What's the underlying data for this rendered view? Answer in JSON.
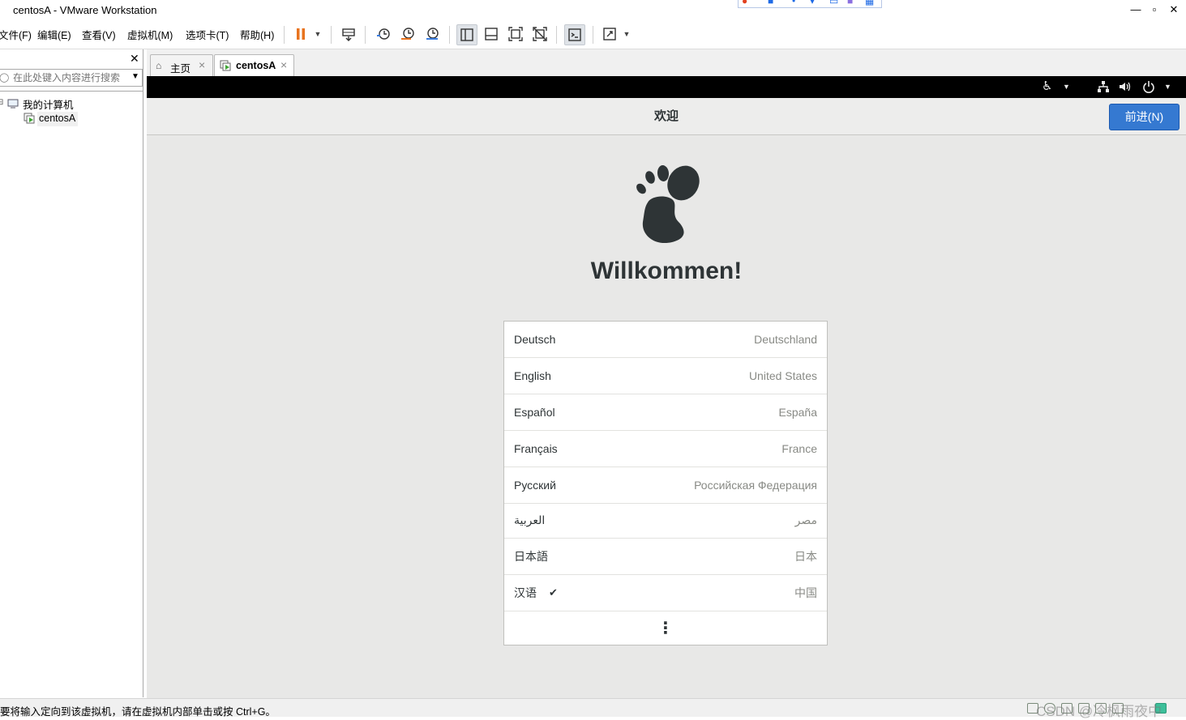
{
  "window": {
    "title": "centosA - VMware Workstation",
    "controls": [
      "minimize-icon",
      "maximize-icon",
      "close-icon"
    ]
  },
  "menu": [
    "文件(F)",
    "编辑(E)",
    "查看(V)",
    "虚拟机(M)",
    "选项卡(T)",
    "帮助(H)"
  ],
  "toolbar_icons": [
    "pause-icon",
    "send-ctrl-alt-del-icon",
    "snapshot-icon",
    "revert-snapshot-icon",
    "snapshot-manager-icon",
    "show-library-icon",
    "thumbnail-bar-icon",
    "full-screen-icon",
    "unity-icon",
    "console-view-icon",
    "stretch-icon"
  ],
  "library": {
    "search_placeholder": "在此处键入内容进行搜索",
    "tree": [
      {
        "label": "我的计算机",
        "icon": "computer-icon"
      },
      {
        "label": "centosA",
        "icon": "vm-running-icon",
        "selected": true
      }
    ]
  },
  "tabs": [
    {
      "label": "主页",
      "icon": "home-icon",
      "active": false
    },
    {
      "label": "centosA",
      "icon": "vm-running-icon",
      "active": true
    }
  ],
  "guest": {
    "topbar_icons": [
      "accessibility-icon",
      "network-icon",
      "volume-icon",
      "power-icon"
    ],
    "header_title": "欢迎",
    "next_button": "前进(N)",
    "welcome": "Willkommen!",
    "languages": [
      {
        "name": "Deutsch",
        "region": "Deutschland",
        "selected": false
      },
      {
        "name": "English",
        "region": "United States",
        "selected": false
      },
      {
        "name": "Español",
        "region": "España",
        "selected": false
      },
      {
        "name": "Français",
        "region": "France",
        "selected": false
      },
      {
        "name": "Русский",
        "region": "Российская Федерация",
        "selected": false
      },
      {
        "name": "العربية",
        "region": "مصر",
        "selected": false
      },
      {
        "name": "日本語",
        "region": "日本",
        "selected": false
      },
      {
        "name": "汉语",
        "region": "中国",
        "selected": true
      }
    ],
    "check_mark": "✔",
    "more_glyph": "⋮"
  },
  "statusbar": {
    "text": "要将输入定向到该虚拟机，请在虚拟机内部单击或按 Ctrl+G。",
    "watermark": "CSDN @冷枫雨夜中"
  },
  "colors": {
    "accent_button": "#3579d1",
    "pause_orange": "#e8731e",
    "guest_background": "#e8e8e7"
  }
}
